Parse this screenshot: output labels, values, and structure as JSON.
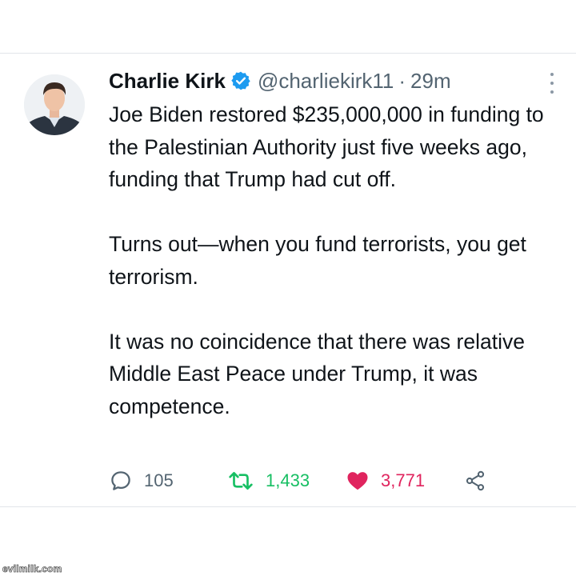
{
  "tweet": {
    "author_name": "Charlie Kirk",
    "handle": "@charliekirk11",
    "separator": "·",
    "time": "29m",
    "text": [
      "Joe Biden restored $235,000,000 in funding to the Palestinian Authority just five weeks ago, funding that Trump had cut off.",
      "Turns out—when you fund terrorists, you get terrorism.",
      "It was no coincidence that there was relative Middle East Peace under Trump, it was competence."
    ],
    "actions": {
      "replies": "105",
      "retweets": "1,433",
      "likes": "3,771"
    },
    "icons": {
      "verified": "verified-badge-icon",
      "more": "more-vertical-icon",
      "reply": "reply-icon",
      "retweet": "retweet-icon",
      "like": "heart-icon",
      "share": "share-icon"
    },
    "colors": {
      "verified": "#1d9bf0",
      "retweet": "#17bf63",
      "like": "#e0245e",
      "secondary_text": "#536471"
    }
  },
  "watermark": "evilmilk.com"
}
